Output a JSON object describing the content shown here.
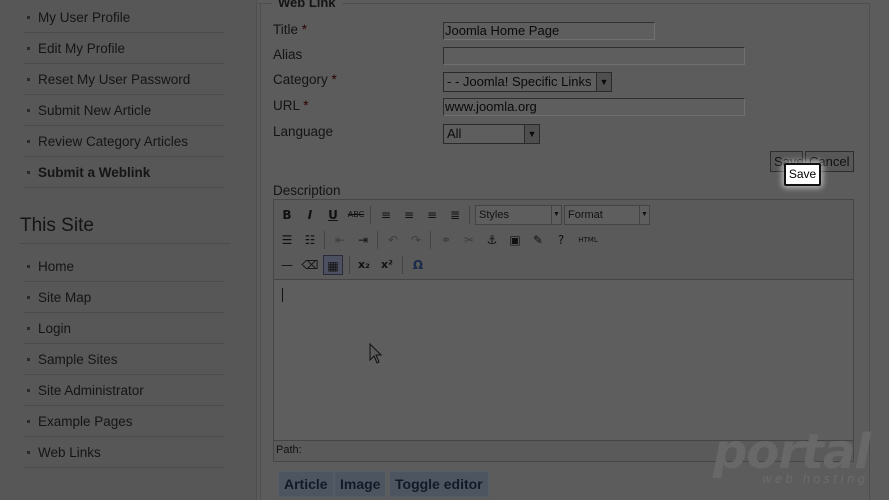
{
  "sidebar": {
    "user_menu": [
      {
        "label": "My User Profile"
      },
      {
        "label": "Edit My Profile"
      },
      {
        "label": "Reset My User Password"
      },
      {
        "label": "Submit New Article"
      },
      {
        "label": "Review Category Articles"
      },
      {
        "label": "Submit a Weblink"
      }
    ],
    "site_heading": "This Site",
    "site_menu": [
      {
        "label": "Home"
      },
      {
        "label": "Site Map"
      },
      {
        "label": "Login"
      },
      {
        "label": "Sample Sites"
      },
      {
        "label": "Site Administrator"
      },
      {
        "label": "Example Pages"
      },
      {
        "label": "Web Links"
      }
    ]
  },
  "form": {
    "legend": "Web Link",
    "required_mark": "*",
    "title_label": "Title",
    "title_value": "Joomla Home Page",
    "alias_label": "Alias",
    "alias_value": "",
    "category_label": "Category",
    "category_value": "- - Joomla! Specific Links",
    "url_label": "URL",
    "url_value": "www.joomla.org",
    "language_label": "Language",
    "language_value": "All",
    "save_label": "Save",
    "cancel_label": "Cancel",
    "tooltip": "Save",
    "description_label": "Description"
  },
  "editor": {
    "styles_select": "Styles",
    "format_select": "Format",
    "path_label": "Path:",
    "buttons": {
      "bold": "B",
      "italic": "I",
      "underline": "U",
      "strike": "ABC",
      "html": "HTML",
      "omega": "Ω"
    },
    "bottom_buttons": [
      "Article",
      "Image",
      "Toggle editor"
    ]
  },
  "watermark": {
    "brand": "portal",
    "tagline": "web hosting"
  },
  "colors": {
    "overlay_background": "#5a5a5a",
    "editor_button": "#4d5560",
    "tooltip_background": "#ffffff"
  }
}
